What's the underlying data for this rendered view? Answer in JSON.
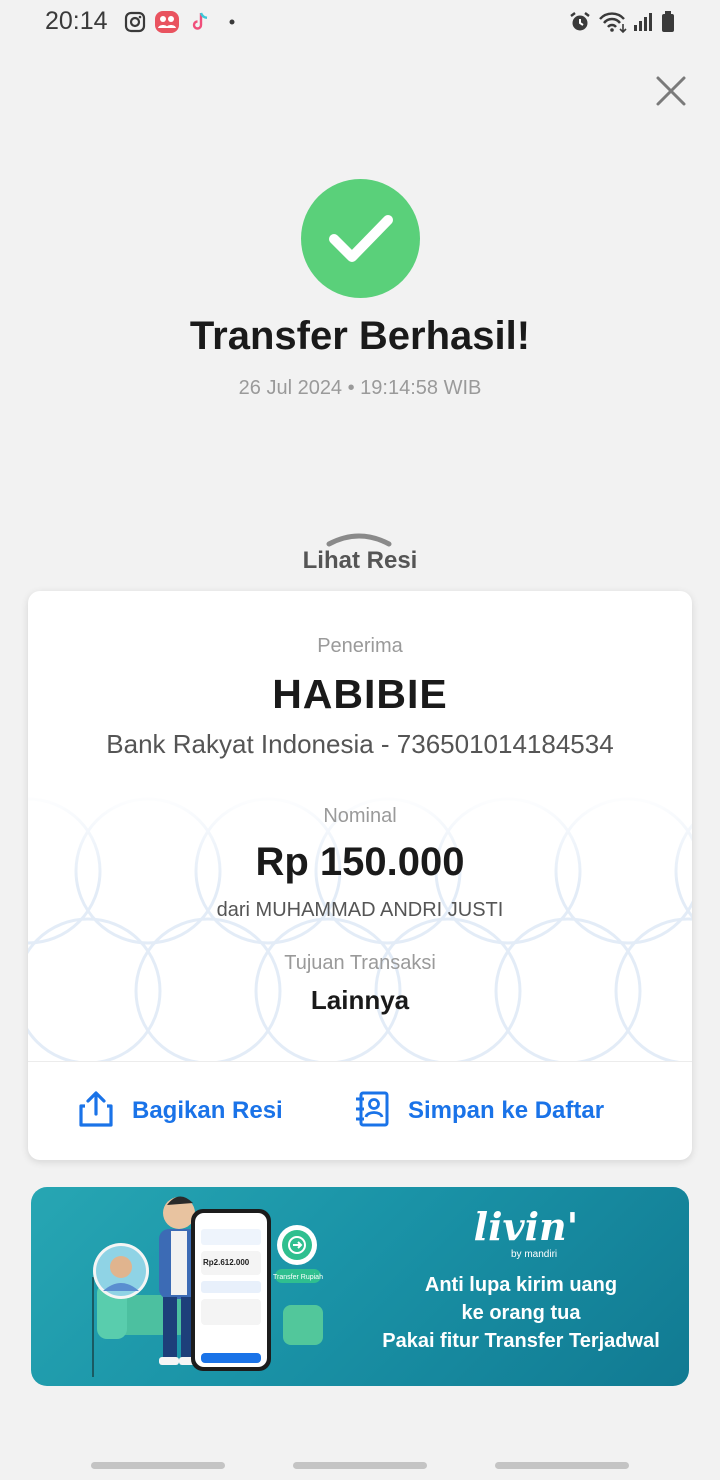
{
  "status_bar": {
    "time": "20:14",
    "left_icons": [
      "instagram-icon",
      "group-app-icon",
      "tiktok-icon",
      "dot-icon"
    ],
    "right_icons": [
      "alarm-icon",
      "wifi-icon",
      "signal-icon",
      "battery-icon"
    ]
  },
  "header": {
    "close_icon": "close-icon"
  },
  "success": {
    "title": "Transfer Berhasil!",
    "datetime": "26 Jul 2024 • 19:14:58 WIB",
    "color": "#5ad07a"
  },
  "resi": {
    "label": "Lihat Resi"
  },
  "receipt": {
    "recipient_caption": "Penerima",
    "recipient_name": "HABIBIE",
    "recipient_bank": "Bank Rakyat Indonesia - 736501014184534",
    "amount_caption": "Nominal",
    "amount": "Rp 150.000",
    "sender": "dari MUHAMMAD ANDRI JUSTI",
    "purpose_caption": "Tujuan Transaksi",
    "purpose": "Lainnya",
    "share_label": "Bagikan Resi",
    "save_label": "Simpan ke Daftar",
    "accent": "#1a73e8"
  },
  "promo": {
    "logo": "livin'",
    "logo_sub": "by mandiri",
    "line1": "Anti lupa kirim uang",
    "line2": "ke orang tua",
    "line3": "Pakai fitur Transfer Terjadwal",
    "phone_amount": "Rp2.612.000",
    "phone_button": "Transfer Rupiah"
  }
}
